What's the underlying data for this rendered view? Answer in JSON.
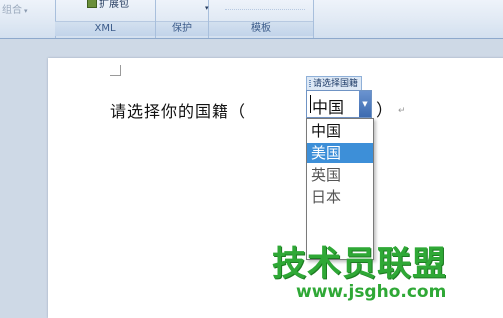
{
  "ribbon": {
    "groups": [
      {
        "id": "combine",
        "label": "组合"
      },
      {
        "id": "xml",
        "label": "XML",
        "button_label": "扩展包"
      },
      {
        "id": "protect",
        "label": "保护"
      },
      {
        "id": "templates",
        "label": "模板"
      }
    ]
  },
  "document": {
    "prompt_text": "请选择你的国籍（",
    "close_paren": "）",
    "para_mark": "↵"
  },
  "content_control": {
    "title": "请选择国籍",
    "value": "中国",
    "options": [
      "中国",
      "美国",
      "英国",
      "日本"
    ],
    "selected_index": 1
  },
  "watermark": {
    "main": "技术员联盟",
    "url": "www.jsgho.com"
  }
}
